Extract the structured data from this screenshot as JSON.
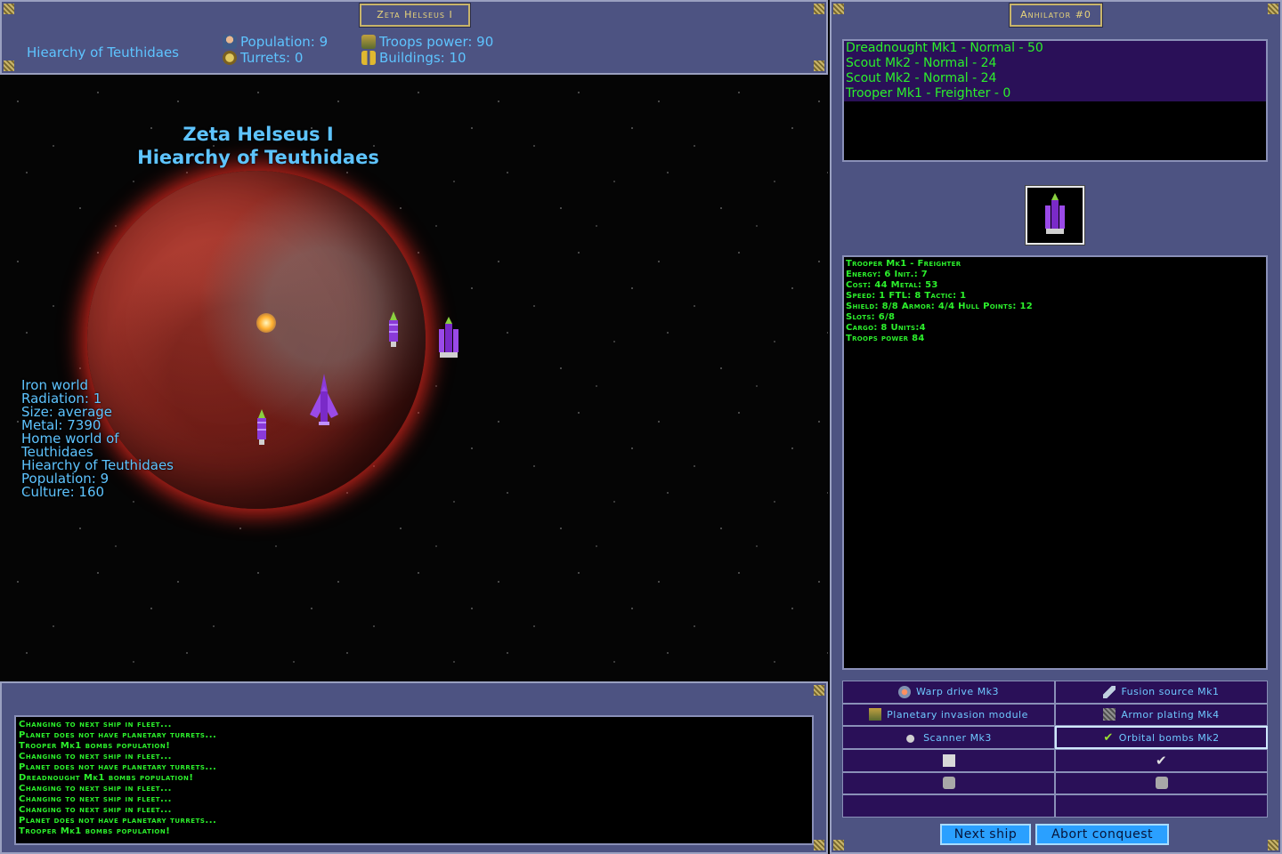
{
  "planet_panel": {
    "title": "Zeta Helseus I",
    "empire": "Hiearchy of Teuthidaes",
    "population_label": "Population: 9",
    "turrets_label": "Turrets: 0",
    "troops_label": "Troops power: 90",
    "buildings_label": "Buildings: 10"
  },
  "space_view": {
    "planet_name": "Zeta Helseus I",
    "planet_owner": "Hiearchy of Teuthidaes",
    "info": [
      "Iron world",
      "Radiation: 1",
      "Size: average",
      "Metal: 7390",
      "Home world of",
      "Teuthidaes",
      "Hiearchy of Teuthidaes",
      "Population: 9",
      "Culture: 160"
    ]
  },
  "log": [
    "Changing to next ship in fleet...",
    "Planet does not have planetary turrets...",
    "Trooper Mk1 bombs population!",
    "Changing to next ship in fleet...",
    "Planet does not have planetary turrets...",
    "Dreadnought Mk1 bombs population!",
    "Changing to next ship in fleet...",
    "Changing to next ship in fleet...",
    "Changing to next ship in fleet...",
    "Planet does not have planetary turrets...",
    "Trooper Mk1 bombs population!"
  ],
  "fleet_panel": {
    "title": "Anhilator #0",
    "ships": [
      "Dreadnought Mk1 - Normal - 50",
      "Scout Mk2 - Normal - 24",
      "Scout Mk2 - Normal - 24",
      "Trooper Mk1 - Freighter - 0"
    ],
    "stats": [
      "Trooper Mk1 - Freighter",
      "Energy: 6 Init.: 7",
      "Cost: 44 Metal: 53",
      "Speed: 1 FTL: 8 Tactic: 1",
      "Shield: 8/8 Armor: 4/4 Hull Points: 12",
      "Slots: 6/8",
      "Cargo: 8 Units:4",
      "Troops power 84"
    ],
    "modules": [
      {
        "label": "Warp drive Mk3",
        "icon": "warp-drive-icon"
      },
      {
        "label": "Fusion source Mk1",
        "icon": "fusion-source-icon"
      },
      {
        "label": "Planetary invasion module",
        "icon": "invasion-module-icon"
      },
      {
        "label": "Armor plating Mk4",
        "icon": "armor-plating-icon"
      },
      {
        "label": "Scanner Mk3",
        "icon": "scanner-icon"
      },
      {
        "label": "Orbital bombs Mk2",
        "icon": "check-icon"
      }
    ],
    "next_ship_label": "Next ship",
    "abort_label": "Abort conquest"
  },
  "colors": {
    "panel": "#4d5382",
    "console_text": "#2cf02c",
    "label_blue": "#5ec4ff",
    "row_purple": "#2a1058",
    "button": "#2aa0ff"
  }
}
